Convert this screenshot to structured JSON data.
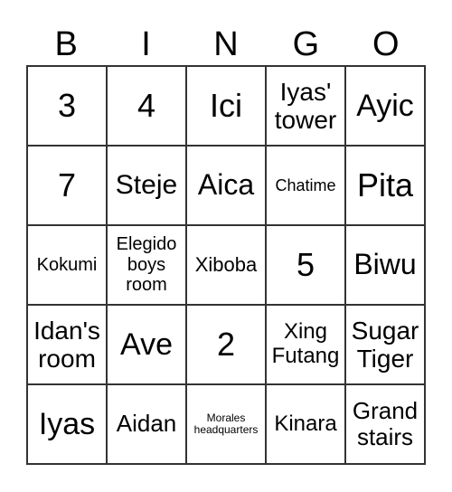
{
  "header": [
    "B",
    "I",
    "N",
    "G",
    "O"
  ],
  "cells": [
    {
      "text": "3",
      "size": 36
    },
    {
      "text": "4",
      "size": 36
    },
    {
      "text": "Ici",
      "size": 36
    },
    {
      "text": "Iyas' tower",
      "size": 28
    },
    {
      "text": "Ayic",
      "size": 34
    },
    {
      "text": "7",
      "size": 36
    },
    {
      "text": "Steje",
      "size": 30
    },
    {
      "text": "Aica",
      "size": 32
    },
    {
      "text": "Chatime",
      "size": 18
    },
    {
      "text": "Pita",
      "size": 36
    },
    {
      "text": "Kokumi",
      "size": 20
    },
    {
      "text": "Elegido boys room",
      "size": 20
    },
    {
      "text": "Xiboba",
      "size": 22
    },
    {
      "text": "5",
      "size": 36
    },
    {
      "text": "Biwu",
      "size": 32
    },
    {
      "text": "Idan's room",
      "size": 28
    },
    {
      "text": "Ave",
      "size": 34
    },
    {
      "text": "2",
      "size": 36
    },
    {
      "text": "Xing Futang",
      "size": 24
    },
    {
      "text": "Sugar Tiger",
      "size": 28
    },
    {
      "text": "Iyas",
      "size": 34
    },
    {
      "text": "Aidan",
      "size": 26
    },
    {
      "text": "Morales headquarters",
      "size": 12
    },
    {
      "text": "Kinara",
      "size": 24
    },
    {
      "text": "Grand stairs",
      "size": 26
    }
  ]
}
